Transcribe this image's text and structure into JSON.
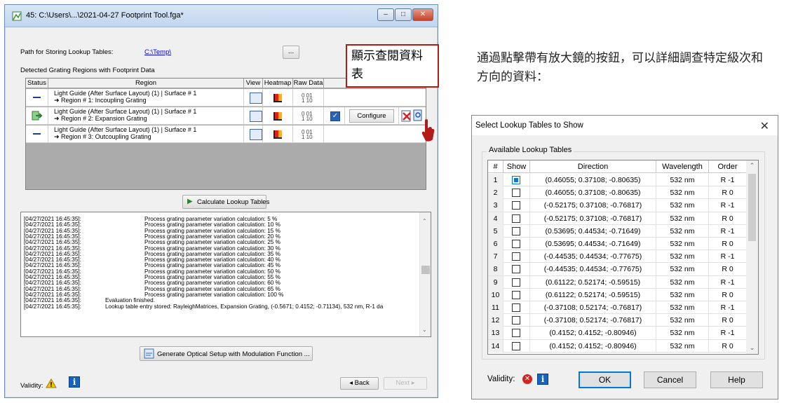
{
  "main_window": {
    "title": "45: C:\\Users\\...\\2021-04-27 Footprint Tool.fga*",
    "window_buttons": {
      "minimize": "–",
      "maximize": "□",
      "close": "✕"
    },
    "path_label": "Path for Storing Lookup Tables:",
    "path_value": "C:\\Temp\\",
    "browse_label": "...",
    "section_label": "Detected Grating Regions with Footprint Data",
    "table_headers": [
      "Status",
      "Region",
      "View",
      "Heatmap",
      "Raw Data"
    ],
    "rows": [
      {
        "line1": "Light Guide (After Surface Layout) (1) | Surface # 1",
        "line2": "➜ Region # 1: Incoupling Grating",
        "raw": "0 01\n1 10"
      },
      {
        "line1": "Light Guide (After Surface Layout) (1) | Surface # 1",
        "line2": "➜ Region # 2: Expansion Grating",
        "raw": "0 01\n1 10",
        "configure": "Configure"
      },
      {
        "line1": "Light Guide (After Surface Layout) (1) | Surface # 1",
        "line2": "➜ Region # 3: Outcoupling Grating",
        "raw": "0 01\n1 10"
      }
    ],
    "calc_button": "Calculate Lookup Tables",
    "log": [
      {
        "ts": "[04/27/2021 16:45:35]:",
        "msg": "Process grating parameter variation calculation: 5 %"
      },
      {
        "ts": "[04/27/2021 16:45:35]:",
        "msg": "Process grating parameter variation calculation: 10 %"
      },
      {
        "ts": "[04/27/2021 16:45:35]:",
        "msg": "Process grating parameter variation calculation: 15 %"
      },
      {
        "ts": "[04/27/2021 16:45:35]:",
        "msg": "Process grating parameter variation calculation: 20 %"
      },
      {
        "ts": "[04/27/2021 16:45:35]:",
        "msg": "Process grating parameter variation calculation: 25 %"
      },
      {
        "ts": "[04/27/2021 16:45:35]:",
        "msg": "Process grating parameter variation calculation: 30 %"
      },
      {
        "ts": "[04/27/2021 16:45:35]:",
        "msg": "Process grating parameter variation calculation: 35 %"
      },
      {
        "ts": "[04/27/2021 16:45:35]:",
        "msg": "Process grating parameter variation calculation: 40 %"
      },
      {
        "ts": "[04/27/2021 16:45:35]:",
        "msg": "Process grating parameter variation calculation: 45 %"
      },
      {
        "ts": "[04/27/2021 16:45:35]:",
        "msg": "Process grating parameter variation calculation: 50 %"
      },
      {
        "ts": "[04/27/2021 16:45:35]:",
        "msg": "Process grating parameter variation calculation: 55 %"
      },
      {
        "ts": "[04/27/2021 16:45:35]:",
        "msg": "Process grating parameter variation calculation: 60 %"
      },
      {
        "ts": "[04/27/2021 16:45:35]:",
        "msg": "Process grating parameter variation calculation: 65 %"
      },
      {
        "ts": "[04/27/2021 16:45:35]:",
        "msg": "Process grating parameter variation calculation: 100 %"
      },
      {
        "ts": "[04/27/2021 16:45:35]:",
        "msg": "Evaluation finished."
      },
      {
        "ts": "[04/27/2021 16:45:35]:",
        "msg": "Lookup table entry stored: RayleighMatrices, Expansion Grating, (-0.5671; 0.4152; -0.71134), 532 nm, R-1 da"
      }
    ],
    "generate_button": "Generate Optical Setup with Modulation Function ...",
    "validity_label": "Validity:",
    "back_button": "◂ Back",
    "next_button": "Next ▸"
  },
  "callout": {
    "text": "顯示查閱資料表"
  },
  "explanation": {
    "text": "通過點擊帶有放大鏡的按鈕，可以詳細調查特定級次和方向的資料："
  },
  "dialog": {
    "title": "Select Lookup Tables to Show",
    "close": "✕",
    "group_label": "Available Lookup Tables",
    "headers": [
      "#",
      "Show",
      "Direction",
      "Wavelength",
      "Order"
    ],
    "rows": [
      {
        "n": "1",
        "direction": "(0.46055; 0.37108; -0.80635)",
        "wavelength": "532 nm",
        "order": "R -1",
        "show": true
      },
      {
        "n": "2",
        "direction": "(0.46055; 0.37108; -0.80635)",
        "wavelength": "532 nm",
        "order": "R 0",
        "show": false
      },
      {
        "n": "3",
        "direction": "(-0.52175; 0.37108; -0.76817)",
        "wavelength": "532 nm",
        "order": "R -1",
        "show": false
      },
      {
        "n": "4",
        "direction": "(-0.52175; 0.37108; -0.76817)",
        "wavelength": "532 nm",
        "order": "R 0",
        "show": false
      },
      {
        "n": "5",
        "direction": "(0.53695; 0.44534; -0.71649)",
        "wavelength": "532 nm",
        "order": "R -1",
        "show": false
      },
      {
        "n": "6",
        "direction": "(0.53695; 0.44534; -0.71649)",
        "wavelength": "532 nm",
        "order": "R 0",
        "show": false
      },
      {
        "n": "7",
        "direction": "(-0.44535; 0.44534; -0.77675)",
        "wavelength": "532 nm",
        "order": "R -1",
        "show": false
      },
      {
        "n": "8",
        "direction": "(-0.44535; 0.44534; -0.77675)",
        "wavelength": "532 nm",
        "order": "R 0",
        "show": false
      },
      {
        "n": "9",
        "direction": "(0.61122; 0.52174; -0.59515)",
        "wavelength": "532 nm",
        "order": "R -1",
        "show": false
      },
      {
        "n": "10",
        "direction": "(0.61122; 0.52174; -0.59515)",
        "wavelength": "532 nm",
        "order": "R 0",
        "show": false
      },
      {
        "n": "11",
        "direction": "(-0.37108; 0.52174; -0.76817)",
        "wavelength": "532 nm",
        "order": "R -1",
        "show": false
      },
      {
        "n": "12",
        "direction": "(-0.37108; 0.52174; -0.76817)",
        "wavelength": "532 nm",
        "order": "R 0",
        "show": false
      },
      {
        "n": "13",
        "direction": "(0.4152; 0.4152; -0.80946)",
        "wavelength": "532 nm",
        "order": "R -1",
        "show": false
      },
      {
        "n": "14",
        "direction": "(0.4152; 0.4152; -0.80946)",
        "wavelength": "532 nm",
        "order": "R 0",
        "show": false
      }
    ],
    "validity_label": "Validity:",
    "ok": "OK",
    "cancel": "Cancel",
    "help": "Help"
  },
  "colors": {
    "accent": "#0078d7",
    "callout_border": "#b31b1b",
    "info_blue": "#1565c0",
    "error_red": "#d32323"
  }
}
